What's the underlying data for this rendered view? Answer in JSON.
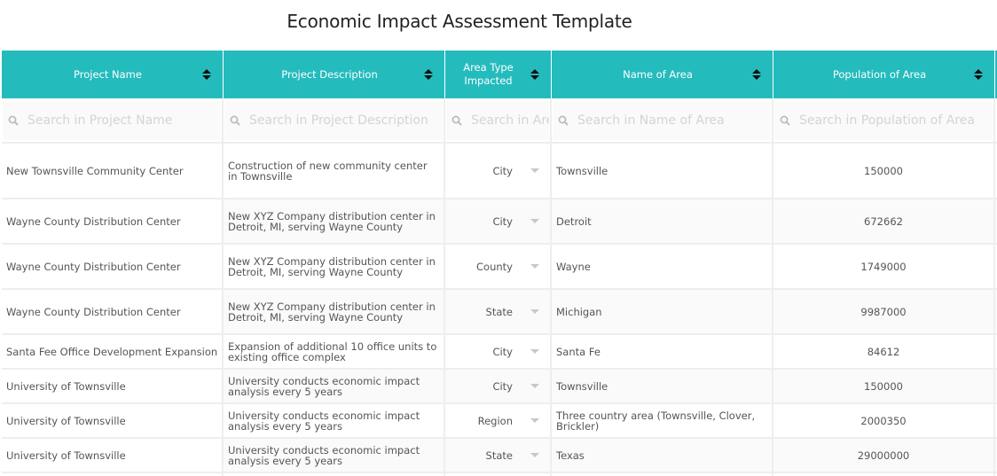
{
  "page": {
    "title": "Economic Impact Assessment Template"
  },
  "table": {
    "columns": [
      {
        "label": "Project Name",
        "filter_placeholder": "Search in Project Name",
        "sort_icon": "sort-icon"
      },
      {
        "label": "Project Description",
        "filter_placeholder": "Search in Project Description",
        "sort_icon": "sort-icon"
      },
      {
        "label": "Area Type Impacted",
        "filter_placeholder": "Search in Area Type Impacted",
        "sort_icon": "sort-icon"
      },
      {
        "label": "Name of Area",
        "filter_placeholder": "Search in Name of Area",
        "sort_icon": "sort-icon"
      },
      {
        "label": "Population of Area",
        "filter_placeholder": "Search in Population of Area",
        "sort_icon": "sort-icon"
      }
    ],
    "rows": [
      {
        "project_name": "New Townsville Community Center",
        "description": "Construction of new community center in Townsville",
        "area_type": "City",
        "area_name": "Townsville",
        "population": "150000"
      },
      {
        "project_name": "Wayne County Distribution Center",
        "description": "New XYZ Company distribution center in Detroit, MI, serving Wayne County",
        "area_type": "City",
        "area_name": "Detroit",
        "population": "672662"
      },
      {
        "project_name": "Wayne County Distribution Center",
        "description": "New XYZ Company distribution center in Detroit, MI, serving Wayne County",
        "area_type": "County",
        "area_name": "Wayne",
        "population": "1749000"
      },
      {
        "project_name": "Wayne County Distribution Center",
        "description": "New XYZ Company distribution center in Detroit, MI, serving Wayne County",
        "area_type": "State",
        "area_name": "Michigan",
        "population": "9987000"
      },
      {
        "project_name": "Santa Fee Office Development Expansion",
        "description": "Expansion of additional 10 office units to existing office complex",
        "area_type": "City",
        "area_name": "Santa Fe",
        "population": "84612"
      },
      {
        "project_name": "University of Townsville",
        "description": "University conducts economic impact analysis every 5 years",
        "area_type": "City",
        "area_name": "Townsville",
        "population": "150000"
      },
      {
        "project_name": "University of Townsville",
        "description": "University conducts economic impact analysis every 5 years",
        "area_type": "Region",
        "area_name": "Three country area (Townsville, Clover, Brickler)",
        "population": "2000350"
      },
      {
        "project_name": "University of Townsville",
        "description": "University conducts economic impact analysis every 5 years",
        "area_type": "State",
        "area_name": "Texas",
        "population": "29000000"
      }
    ]
  },
  "colors": {
    "header_bg": "#24bbbd",
    "header_text": "#ffffff",
    "border": "#eeeeee",
    "alt_row_bg": "#fafafa"
  }
}
